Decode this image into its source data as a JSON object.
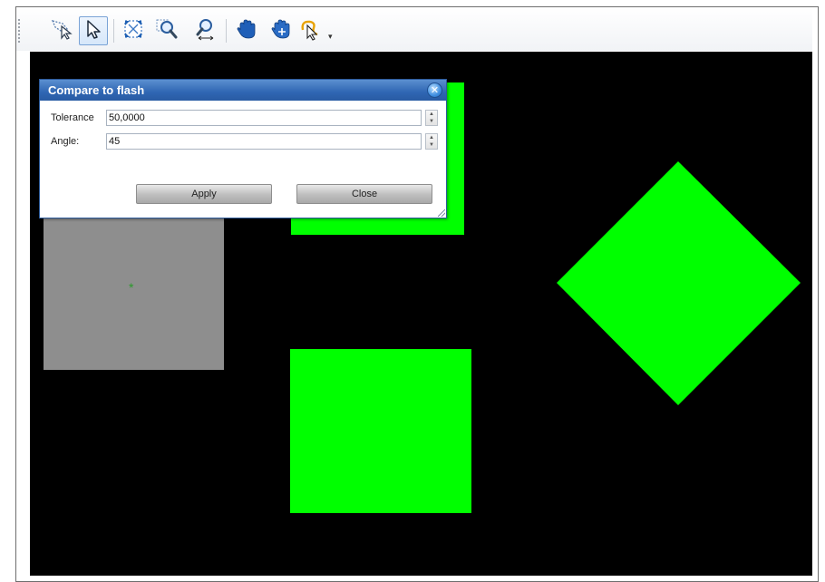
{
  "toolbar": {
    "tools": [
      {
        "name": "lasso-select-icon"
      },
      {
        "name": "select-pointer-icon",
        "active": true
      },
      {
        "name": "zoom-extents-icon"
      },
      {
        "name": "zoom-window-icon"
      },
      {
        "name": "zoom-realtime-icon"
      },
      {
        "name": "pan-hand-icon"
      },
      {
        "name": "pan-hand-alt-icon"
      },
      {
        "name": "snap-mode-icon"
      }
    ]
  },
  "dialog": {
    "title": "Compare to flash",
    "close_glyph": "✕",
    "tolerance": {
      "label": "Tolerance",
      "value": "50,0000"
    },
    "angle": {
      "label": "Angle:",
      "value": "45"
    },
    "apply_label": "Apply",
    "close_label": "Close"
  },
  "canvas": {
    "background": "#000000",
    "shape_color": "#00ff00",
    "selected_shape_color": "#8e8e8e",
    "crosshair_glyph": "*"
  }
}
